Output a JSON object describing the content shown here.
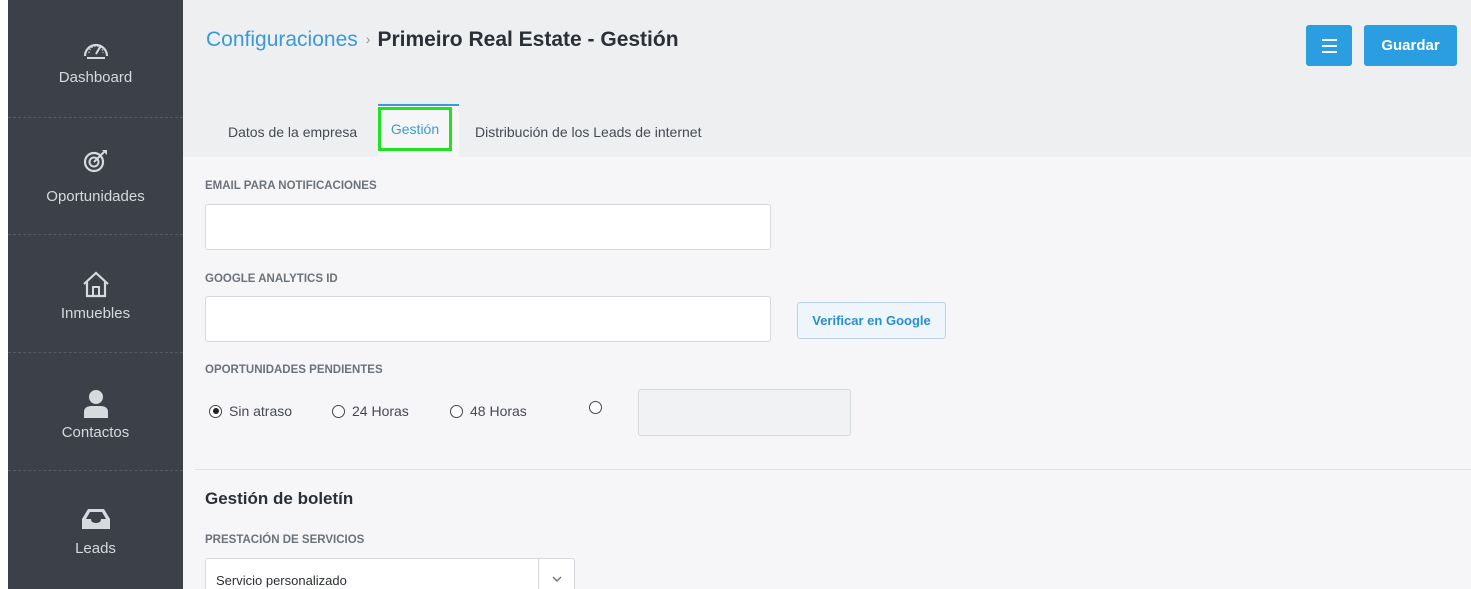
{
  "sidebar": {
    "items": [
      {
        "label": "Dashboard",
        "icon": "dashboard-gauge-icon"
      },
      {
        "label": "Oportunidades",
        "icon": "target-icon"
      },
      {
        "label": "Inmuebles",
        "icon": "home-icon"
      },
      {
        "label": "Contactos",
        "icon": "user-icon"
      },
      {
        "label": "Leads",
        "icon": "inbox-icon"
      }
    ]
  },
  "header": {
    "breadcrumb_link": "Configuraciones",
    "breadcrumb_sep": "›",
    "breadcrumb_current": "Primeiro Real Estate - Gestión",
    "save_label": "Guardar"
  },
  "tabs": [
    {
      "label": "Datos de la empresa"
    },
    {
      "label": "Gestión",
      "active": true
    },
    {
      "label": "Distribución de los Leads de internet"
    }
  ],
  "form": {
    "email_label": "EMAIL PARA NOTIFICACIONES",
    "email_value": "",
    "ga_label": "GOOGLE ANALYTICS ID",
    "ga_value": "",
    "verify_label": "Verificar en Google",
    "pending_label": "OPORTUNIDADES PENDIENTES",
    "pending_options": [
      {
        "label": "Sin atraso",
        "selected": true
      },
      {
        "label": "24 Horas",
        "selected": false
      },
      {
        "label": "48 Horas",
        "selected": false
      },
      {
        "label": "",
        "selected": false
      }
    ],
    "custom_hours_value": ""
  },
  "newsletter": {
    "title": "Gestión de boletín",
    "service_label": "PRESTACIÓN DE SERVICIOS",
    "service_value": "Servicio personalizado"
  },
  "colors": {
    "accent": "#2a9ee0",
    "sidebar_bg": "#3b4049",
    "highlight": "#22e022"
  }
}
